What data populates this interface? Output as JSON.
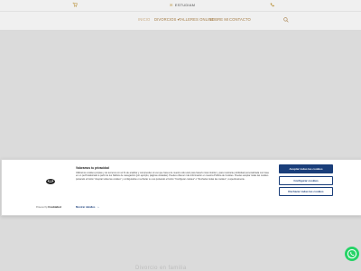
{
  "topbar": {
    "brand": "ESTUDIAM",
    "cart_icon": "cart-icon",
    "phone_icon": "phone-icon",
    "accent": "#c9a14a"
  },
  "nav": {
    "items": [
      {
        "label": "INICIO",
        "active": true
      },
      {
        "label": "DIVORCIOS ▾",
        "active": false
      },
      {
        "label": "TALLERES ONLINE",
        "active": false
      },
      {
        "label": "SOBRE MI",
        "active": false
      },
      {
        "label": "CONTACTO",
        "active": false
      }
    ],
    "search_icon": "search-icon",
    "color": "#b0854a"
  },
  "cookie": {
    "title": "Valoramos tu privacidad",
    "body": "Utilizamos cookies propias y de terceros con el fin de analizar y comprender el uso que haces de nuestro sitio web para hacerlo más intuitivo y para mostrarte publicidad personalizada con base en un perfil elaborado a partir de tus hábitos de navegación (por ejemplo, páginas visitadas). Puedes obtener más información en nuestra Política de Cookies. Puedes aceptar todas las cookies pulsando el botón \"Aceptar todas las cookies\" y configurarlas o rechazar su uso pulsando el botón \"Configurar cookies\" o \"Rechazar todas las cookies\", respectivamente.",
    "powered_prefix": "Powered by",
    "powered_brand": "Cookiebot",
    "details_link": "Mostrar detalles",
    "buttons": {
      "accept_all": "Aceptar todas las cookies",
      "configure": "Configurar cookies",
      "reject_all": "Rechazar todas las cookies"
    },
    "brand_color": "#1a3e7a"
  },
  "hero": {
    "background": "#e9e9e9",
    "below_text": "Divorcio en familia"
  },
  "floating": {
    "whatsapp_icon": "whatsapp-icon",
    "color": "#25d366"
  }
}
